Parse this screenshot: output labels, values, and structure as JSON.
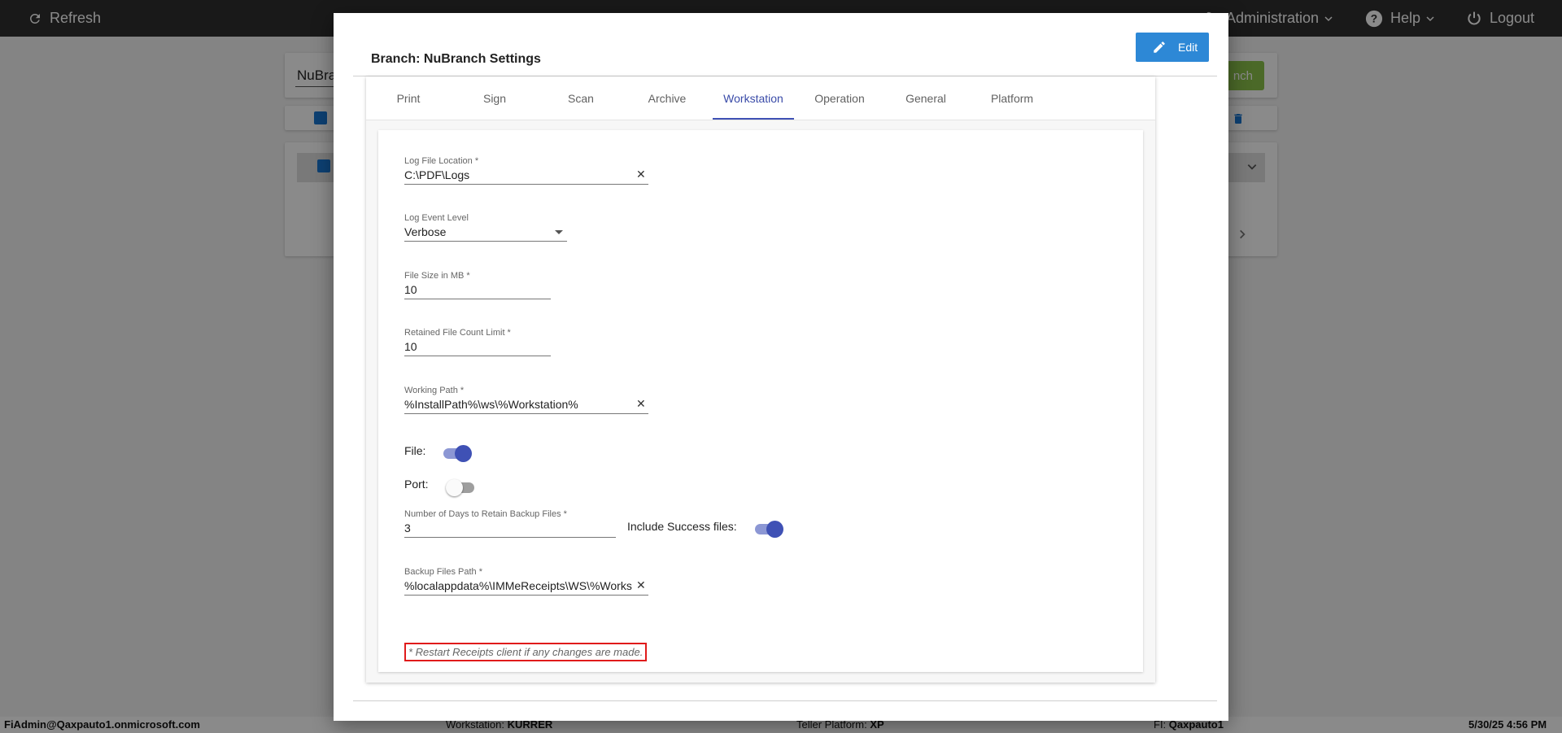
{
  "topbar": {
    "refresh_label": "Refresh",
    "administration_label": "Administration",
    "help_label": "Help",
    "logout_label": "Logout"
  },
  "background": {
    "search_text": "NuBra",
    "add_button_label": "nch"
  },
  "footer": {
    "user": "FiAdmin@Qaxpauto1.onmicrosoft.com",
    "workstation_label": "Workstation:",
    "workstation_value": "KURRER",
    "teller_platform_label": "Teller Platform:",
    "teller_platform_value": "XP",
    "fi_label": "FI:",
    "fi_value": "Qaxpauto1",
    "datetime": "5/30/25 4:56 PM"
  },
  "modal": {
    "title": "Branch: NuBranch Settings",
    "edit_label": "Edit",
    "tabs": [
      {
        "label": "Print"
      },
      {
        "label": "Sign"
      },
      {
        "label": "Scan"
      },
      {
        "label": "Archive"
      },
      {
        "label": "Workstation"
      },
      {
        "label": "Operation"
      },
      {
        "label": "General"
      },
      {
        "label": "Platform"
      }
    ],
    "active_tab": "Workstation",
    "form": {
      "log_file_location": {
        "label": "Log File Location *",
        "value": "C:\\PDF\\Logs"
      },
      "log_event_level": {
        "label": "Log Event Level",
        "value": "Verbose"
      },
      "file_size_mb": {
        "label": "File Size in MB *",
        "value": "10"
      },
      "retained_file_count": {
        "label": "Retained File Count Limit *",
        "value": "10"
      },
      "working_path": {
        "label": "Working Path *",
        "value": "%InstallPath%\\ws\\%Workstation%"
      },
      "file_toggle": {
        "label": "File:",
        "on": true
      },
      "port_toggle": {
        "label": "Port:",
        "on": false
      },
      "backup_days": {
        "label": "Number of Days to Retain Backup Files *",
        "value": "3"
      },
      "include_success": {
        "label": "Include Success files:",
        "on": true
      },
      "backup_path": {
        "label": "Backup Files Path *",
        "value": "%localappdata%\\IMMeReceipts\\WS\\%Workstation%"
      },
      "restart_note": "* Restart Receipts client if any changes are made."
    }
  },
  "colors": {
    "primary": "#3f51b5",
    "edit_button": "#2d88d6",
    "topbar": "#2f2f2f",
    "note_border": "#e01b1b",
    "add_button": "#8bc34a"
  }
}
